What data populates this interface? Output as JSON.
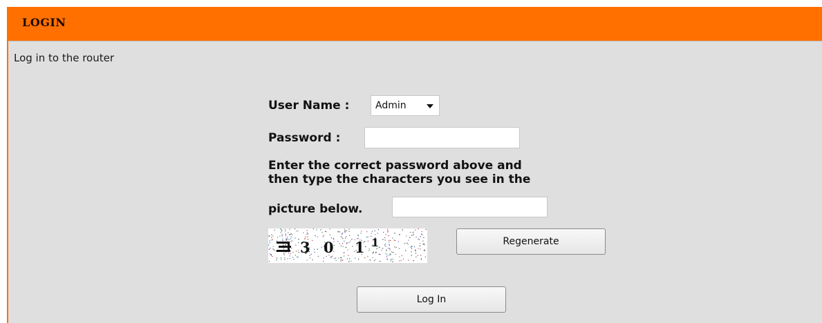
{
  "header": {
    "title": "LOGIN"
  },
  "intro": "Log in to the router",
  "form": {
    "username_label": "User Name :",
    "username_value": "Admin",
    "password_label": "Password :",
    "instructions_line1": "Enter the correct password above and",
    "instructions_line2": "then type the characters you see in the",
    "instructions_line3": "picture below.",
    "regenerate_label": "Regenerate",
    "login_label": "Log In"
  },
  "colors": {
    "accent": "#ff7000",
    "panel_background": "#dfdfdf"
  }
}
